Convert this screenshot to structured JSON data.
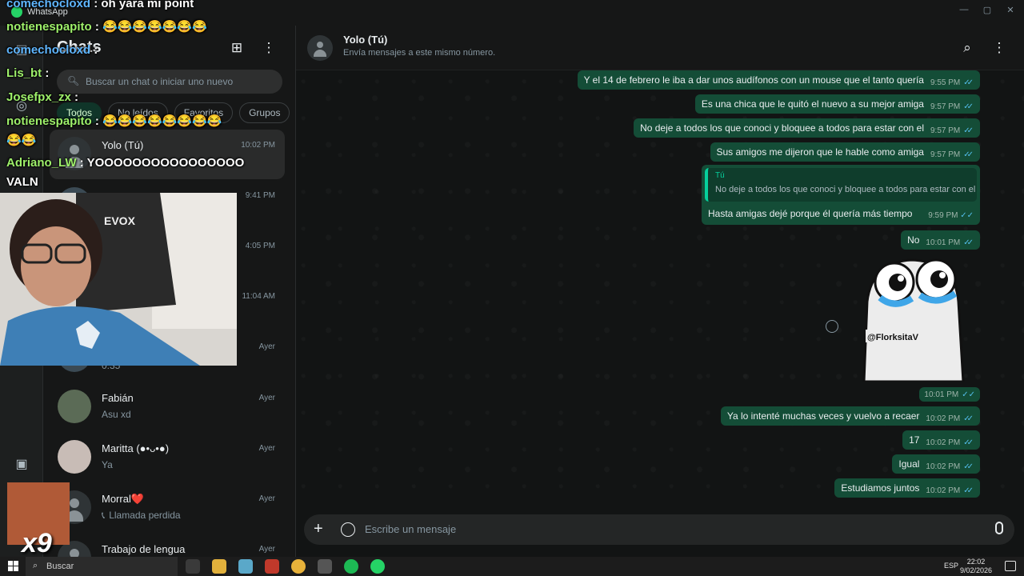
{
  "window": {
    "app_name": "WhatsApp",
    "min": "—",
    "max": "▢",
    "close": "✕"
  },
  "list": {
    "title": "Chats",
    "search_placeholder": "Buscar un chat o iniciar uno nuevo",
    "filters": [
      "Todos",
      "No leídos",
      "Favoritos",
      "Grupos"
    ],
    "chats": [
      {
        "name": "Yolo (Tú)",
        "time": "10:02 PM",
        "last": ""
      },
      {
        "name": "",
        "time": "9:41 PM",
        "last": ""
      },
      {
        "name": "",
        "time": "4:05 PM",
        "last": ""
      },
      {
        "name": "",
        "time": "11:04 AM",
        "last": ""
      },
      {
        "name": "",
        "time": "Ayer",
        "last": "0:35"
      },
      {
        "name": "Fabián",
        "time": "Ayer",
        "last": "Asu xd"
      },
      {
        "name": "Maritta (●•ᴗ•●)",
        "time": "Ayer",
        "last": "Ya"
      },
      {
        "name": "Morral❤️",
        "time": "Ayer",
        "last": "Llamada perdida"
      },
      {
        "name": "Trabajo de lengua",
        "time": "Ayer",
        "last": ""
      }
    ]
  },
  "conversation": {
    "name": "Yolo (Tú)",
    "subtitle": "Envía mensajes a este mismo número.",
    "messages": [
      {
        "text": "Y el 14 de febrero le iba a dar unos audífonos con un mouse que el tanto quería",
        "time": "9:55 PM"
      },
      {
        "text": "Es una chica que le quitó el nuevo a su mejor amiga",
        "time": "9:57 PM"
      },
      {
        "text": "No deje a todos los que conoci y bloquee a todos para estar con el",
        "time": "9:57 PM"
      },
      {
        "text": "Sus amigos me dijeron que le hable como amiga",
        "time": "9:57 PM"
      }
    ],
    "quoted": {
      "author": "Tú",
      "quote": "No deje a todos los que conoci y bloquee a todos para estar con el",
      "text": "Hasta amigas dejé porque él quería más tiempo",
      "time": "9:59 PM"
    },
    "after": [
      {
        "text": "No",
        "time": "10:01 PM"
      }
    ],
    "sticker": {
      "label": "@FlorksitaV",
      "time": "10:01 PM"
    },
    "final": [
      {
        "text": "Ya lo intenté muchas veces y vuelvo a recaer",
        "time": "10:02 PM"
      },
      {
        "text": "17",
        "time": "10:02 PM"
      },
      {
        "text": "Igual",
        "time": "10:02 PM"
      },
      {
        "text": "Estudiamos juntos",
        "time": "10:02 PM"
      }
    ],
    "ticks": "✓✓",
    "composer_placeholder": "Escribe un mensaje"
  },
  "stream_chat": [
    {
      "user": "comechocloxd",
      "text": " : oh yara mi point"
    },
    {
      "user": "notienespapito",
      "text": " : 😂😂😂😂😂😂😂"
    },
    {
      "user": "comechocloxd",
      "text": " : "
    },
    {
      "user": "Lis_bt",
      "text": " : "
    },
    {
      "user": "Josefpx_zx",
      "text": " : "
    },
    {
      "user": "notienespapito",
      "text": " : 😂😂😂😂😂😂😂😂"
    },
    {
      "user": "",
      "text": "😂😂"
    },
    {
      "user": "Adriano_LW",
      "text": " : YOOOOOOOOOOOOOOOO"
    },
    {
      "user": "",
      "text": "VALN"
    }
  ],
  "overlay": {
    "multiplier": "x9",
    "webcam_brand": "EVOX"
  },
  "taskbar": {
    "search": "Buscar",
    "lang": "ESP",
    "time": "22:02",
    "date": "9/02/2026"
  }
}
